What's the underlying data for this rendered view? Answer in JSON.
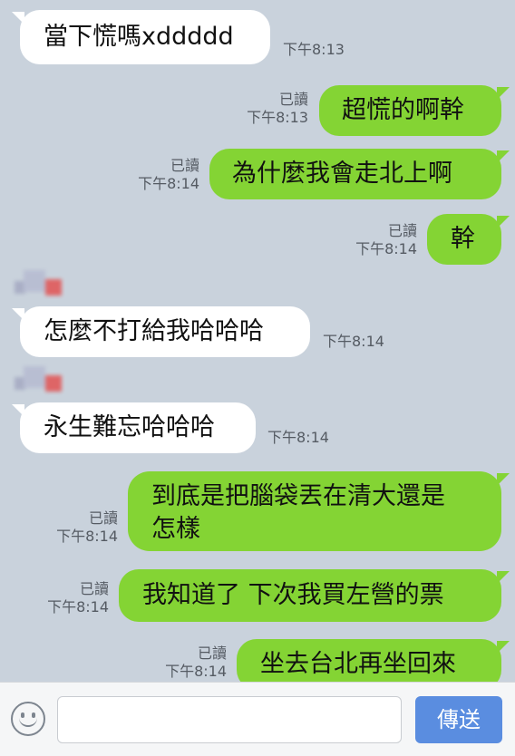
{
  "messages": [
    {
      "side": "in",
      "text": "當下慌嗎xddddd",
      "time": "下午8:13",
      "read": ""
    },
    {
      "side": "out",
      "text": "超慌的啊幹",
      "time": "下午8:13",
      "read": "已讀"
    },
    {
      "side": "out",
      "text": "為什麼我會走北上啊",
      "time": "下午8:14",
      "read": "已讀"
    },
    {
      "side": "out",
      "text": "幹",
      "time": "下午8:14",
      "read": "已讀"
    },
    {
      "side": "in",
      "text": "怎麼不打給我哈哈哈",
      "time": "下午8:14",
      "read": ""
    },
    {
      "side": "in",
      "text": "永生難忘哈哈哈",
      "time": "下午8:14",
      "read": ""
    },
    {
      "side": "out",
      "lines": [
        "到底是把腦袋丟在清大還是",
        "怎樣"
      ],
      "time": "下午8:14",
      "read": "已讀"
    },
    {
      "side": "out",
      "text": "我知道了 下次我買左營的票",
      "time": "下午8:14",
      "read": "已讀"
    },
    {
      "side": "out",
      "text": "坐去台北再坐回來",
      "time": "下午8:14",
      "read": "已讀"
    }
  ],
  "composer": {
    "placeholder": "",
    "send_label": "傳送"
  }
}
